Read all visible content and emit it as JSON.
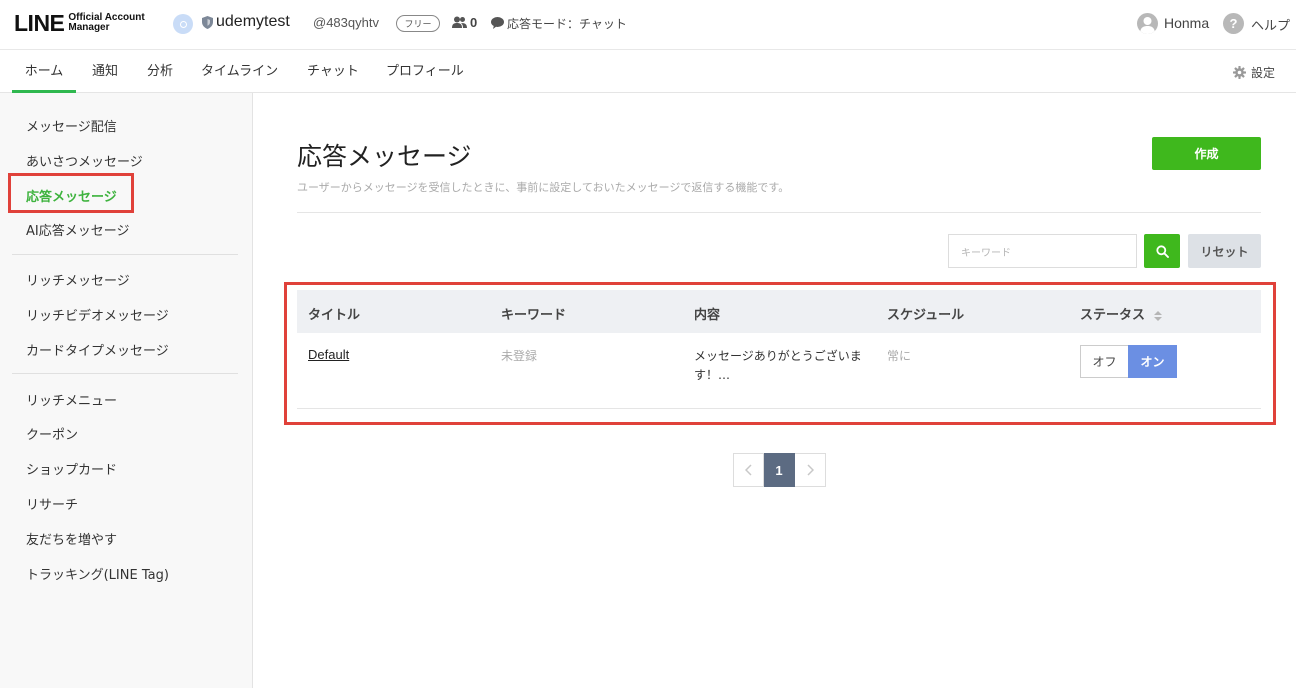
{
  "header": {
    "logo_text": "LINE",
    "logo_sub_1": "Official Account",
    "logo_sub_2": "Manager",
    "account_name": "udemytest",
    "account_id": "@483qyhtv",
    "plan_badge": "フリー",
    "friends_count": "0",
    "mode_label": "応答モード：チャット",
    "user_name": "Honma",
    "help_label": "ヘルプ"
  },
  "nav": {
    "tabs": [
      {
        "label": "ホーム"
      },
      {
        "label": "通知"
      },
      {
        "label": "分析"
      },
      {
        "label": "タイムライン"
      },
      {
        "label": "チャット"
      },
      {
        "label": "プロフィール"
      }
    ],
    "active_tab": "ホーム",
    "settings_label": "設定"
  },
  "sidebar": {
    "items": [
      {
        "label": "メッセージ配信"
      },
      {
        "label": "あいさつメッセージ"
      },
      {
        "label": "応答メッセージ"
      },
      {
        "label": "AI応答メッセージ"
      },
      {
        "label": "リッチメッセージ"
      },
      {
        "label": "リッチビデオメッセージ"
      },
      {
        "label": "カードタイプメッセージ"
      },
      {
        "label": "リッチメニュー"
      },
      {
        "label": "クーポン"
      },
      {
        "label": "ショップカード"
      },
      {
        "label": "リサーチ"
      },
      {
        "label": "友だちを増やす"
      },
      {
        "label": "トラッキング(LINE Tag)"
      }
    ],
    "active_item": "応答メッセージ"
  },
  "main": {
    "title": "応答メッセージ",
    "description": "ユーザーからメッセージを受信したときに、事前に設定しておいたメッセージで返信する機能です。",
    "create_label": "作成",
    "search_placeholder": "キーワード",
    "reset_label": "リセット",
    "table": {
      "headers": [
        "タイトル",
        "キーワード",
        "内容",
        "スケジュール",
        "ステータス"
      ],
      "rows": [
        {
          "title": "Default",
          "keyword": "未登録",
          "content": "メッセージありがとうございます！…",
          "schedule": "常に",
          "status_off": "オフ",
          "status_on": "オン",
          "status": "on"
        }
      ]
    },
    "pagination": {
      "current": "1"
    }
  },
  "colors": {
    "brand_green": "#3fb81d",
    "active_green": "#3eb33e",
    "toggle_on": "#6b8fe3",
    "highlight_red": "#e0413a"
  }
}
